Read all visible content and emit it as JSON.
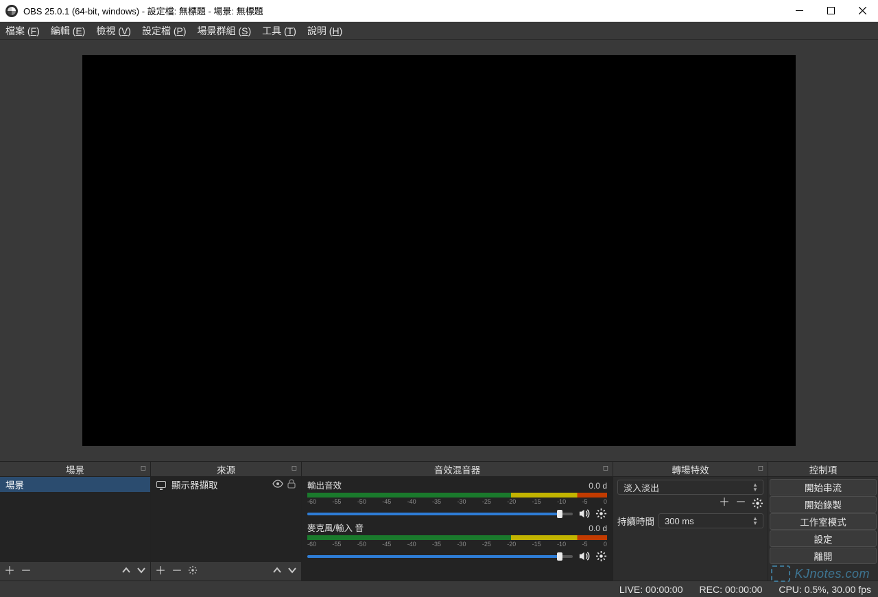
{
  "title": "OBS 25.0.1 (64-bit, windows) - 設定檔: 無標題 - 場景: 無標題",
  "menu": {
    "file": "檔案 (F)",
    "edit": "編輯 (E)",
    "view": "檢視 (V)",
    "profile": "設定檔 (P)",
    "scenecol": "場景群組 (S)",
    "tools": "工具 (T)",
    "help": "說明 (H)"
  },
  "docks": {
    "scenes": {
      "title": "場景",
      "items": [
        "場景"
      ]
    },
    "sources": {
      "title": "來源",
      "items": [
        {
          "name": "顯示器擷取"
        }
      ]
    },
    "mixer": {
      "title": "音效混音器",
      "channels": [
        {
          "name": "輸出音效",
          "db": "0.0 d"
        },
        {
          "name": "麥克風/輸入 音",
          "db": "0.0 d"
        }
      ],
      "ticks": [
        "-60",
        "-55",
        "-50",
        "-45",
        "-40",
        "-35",
        "-30",
        "-25",
        "-20",
        "-15",
        "-10",
        "-5",
        "0"
      ]
    },
    "transitions": {
      "title": "轉場特效",
      "selected": "淡入淡出",
      "duration_label": "持續時間",
      "duration": "300 ms"
    },
    "controls": {
      "title": "控制項",
      "buttons": [
        "開始串流",
        "開始錄製",
        "工作室模式",
        "設定",
        "離開"
      ]
    }
  },
  "status": {
    "live": "LIVE: 00:00:00",
    "rec": "REC: 00:00:00",
    "cpu": "CPU: 0.5%, 30.00 fps"
  },
  "watermark": "KJnotes.com"
}
